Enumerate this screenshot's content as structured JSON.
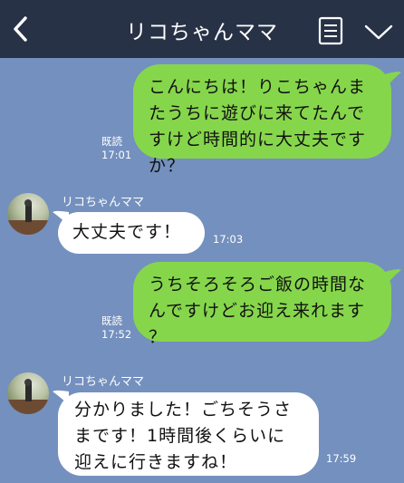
{
  "header": {
    "title": "リコちゃんママ"
  },
  "messages": {
    "m1": {
      "text": "こんにちは！りこちゃんま\nたうちに遊びに来てたんで\nすけど時間的に大丈夫です\nか？",
      "read_label": "既読",
      "time": "17:01"
    },
    "m2": {
      "sender": "リコちゃんママ",
      "text": "大丈夫です！",
      "time": "17:03"
    },
    "m3": {
      "text": "うちそろそろご飯の時間な\nんですけどお迎え来れます\n？",
      "read_label": "既読",
      "time": "17:52"
    },
    "m4": {
      "sender": "リコちゃんママ",
      "text": "分かりました！ごちそうさ\nまです！1時間後くらいに\n迎えに行きますね！",
      "time": "17:59"
    }
  },
  "colors": {
    "header_bg": "#273246",
    "chat_bg": "#7490be",
    "outgoing_bubble": "#86d64c",
    "incoming_bubble": "#ffffff"
  }
}
